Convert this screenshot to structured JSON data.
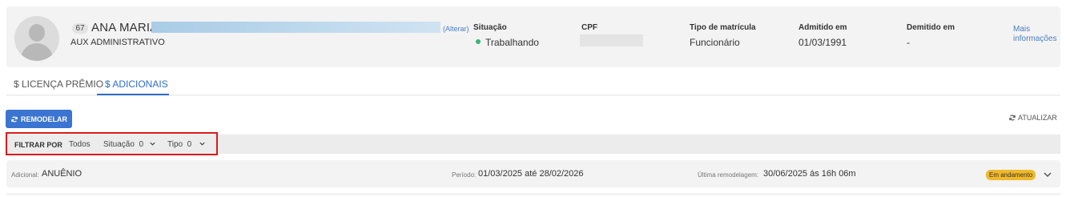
{
  "employee": {
    "code": "67",
    "name": "ANA MARIA",
    "alter_link": "(Alterar)",
    "role": "AUX ADMINISTRATIVO",
    "columns": {
      "situacao_label": "Situação",
      "situacao_value": "Trabalhando",
      "cpf_label": "CPF",
      "tipo_label": "Tipo de matrícula",
      "tipo_value": "Funcionário",
      "admitido_label": "Admitido em",
      "admitido_value": "01/03/1991",
      "demitido_label": "Demitido em",
      "demitido_value": "-"
    },
    "more_info": "Mais informações"
  },
  "tabs": [
    {
      "label": "$ LICENÇA PRÊMIO",
      "active": false
    },
    {
      "label": "$ ADICIONAIS",
      "active": true
    }
  ],
  "toolbar": {
    "remodel_label": "REMODELAR",
    "refresh_label": "ATUALIZAR"
  },
  "filter": {
    "title": "FILTRAR POR",
    "all_label": "Todos",
    "situacao_label": "Situação",
    "situacao_count": "0",
    "tipo_label": "Tipo",
    "tipo_count": "0"
  },
  "rows": [
    {
      "adicional_label": "Adicional:",
      "adicional_value": "ANUÊNIO",
      "periodo_label": "Período:",
      "periodo_value": "01/03/2025 até 28/02/2026",
      "ultima_label": "Última remodelagem:",
      "ultima_value": "30/06/2025 ás 16h 06m",
      "status": "Em andamento"
    }
  ],
  "colors": {
    "accent": "#3b74d1",
    "status_ok": "#3cb371",
    "badge": "#f0b92a",
    "highlight": "#d91a1a"
  }
}
